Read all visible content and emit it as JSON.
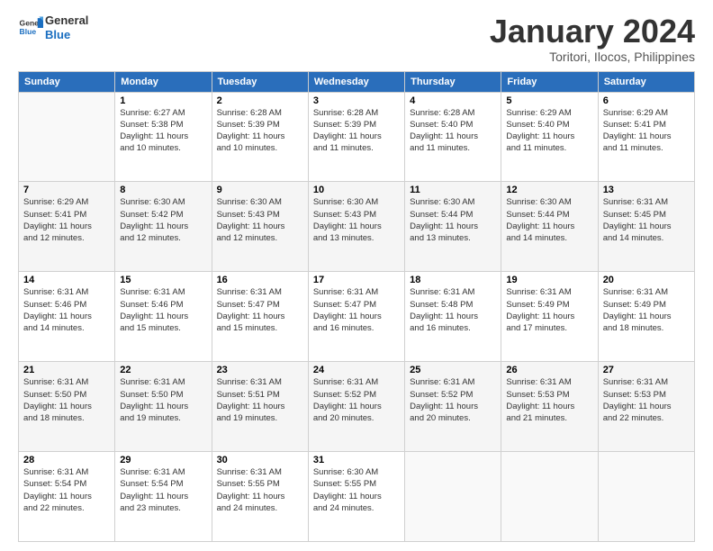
{
  "logo": {
    "line1": "General",
    "line2": "Blue"
  },
  "title": "January 2024",
  "subtitle": "Toritori, Ilocos, Philippines",
  "days_header": [
    "Sunday",
    "Monday",
    "Tuesday",
    "Wednesday",
    "Thursday",
    "Friday",
    "Saturday"
  ],
  "weeks": [
    [
      {
        "num": "",
        "info": ""
      },
      {
        "num": "1",
        "info": "Sunrise: 6:27 AM\nSunset: 5:38 PM\nDaylight: 11 hours\nand 10 minutes."
      },
      {
        "num": "2",
        "info": "Sunrise: 6:28 AM\nSunset: 5:39 PM\nDaylight: 11 hours\nand 10 minutes."
      },
      {
        "num": "3",
        "info": "Sunrise: 6:28 AM\nSunset: 5:39 PM\nDaylight: 11 hours\nand 11 minutes."
      },
      {
        "num": "4",
        "info": "Sunrise: 6:28 AM\nSunset: 5:40 PM\nDaylight: 11 hours\nand 11 minutes."
      },
      {
        "num": "5",
        "info": "Sunrise: 6:29 AM\nSunset: 5:40 PM\nDaylight: 11 hours\nand 11 minutes."
      },
      {
        "num": "6",
        "info": "Sunrise: 6:29 AM\nSunset: 5:41 PM\nDaylight: 11 hours\nand 11 minutes."
      }
    ],
    [
      {
        "num": "7",
        "info": "Sunrise: 6:29 AM\nSunset: 5:41 PM\nDaylight: 11 hours\nand 12 minutes."
      },
      {
        "num": "8",
        "info": "Sunrise: 6:30 AM\nSunset: 5:42 PM\nDaylight: 11 hours\nand 12 minutes."
      },
      {
        "num": "9",
        "info": "Sunrise: 6:30 AM\nSunset: 5:43 PM\nDaylight: 11 hours\nand 12 minutes."
      },
      {
        "num": "10",
        "info": "Sunrise: 6:30 AM\nSunset: 5:43 PM\nDaylight: 11 hours\nand 13 minutes."
      },
      {
        "num": "11",
        "info": "Sunrise: 6:30 AM\nSunset: 5:44 PM\nDaylight: 11 hours\nand 13 minutes."
      },
      {
        "num": "12",
        "info": "Sunrise: 6:30 AM\nSunset: 5:44 PM\nDaylight: 11 hours\nand 14 minutes."
      },
      {
        "num": "13",
        "info": "Sunrise: 6:31 AM\nSunset: 5:45 PM\nDaylight: 11 hours\nand 14 minutes."
      }
    ],
    [
      {
        "num": "14",
        "info": "Sunrise: 6:31 AM\nSunset: 5:46 PM\nDaylight: 11 hours\nand 14 minutes."
      },
      {
        "num": "15",
        "info": "Sunrise: 6:31 AM\nSunset: 5:46 PM\nDaylight: 11 hours\nand 15 minutes."
      },
      {
        "num": "16",
        "info": "Sunrise: 6:31 AM\nSunset: 5:47 PM\nDaylight: 11 hours\nand 15 minutes."
      },
      {
        "num": "17",
        "info": "Sunrise: 6:31 AM\nSunset: 5:47 PM\nDaylight: 11 hours\nand 16 minutes."
      },
      {
        "num": "18",
        "info": "Sunrise: 6:31 AM\nSunset: 5:48 PM\nDaylight: 11 hours\nand 16 minutes."
      },
      {
        "num": "19",
        "info": "Sunrise: 6:31 AM\nSunset: 5:49 PM\nDaylight: 11 hours\nand 17 minutes."
      },
      {
        "num": "20",
        "info": "Sunrise: 6:31 AM\nSunset: 5:49 PM\nDaylight: 11 hours\nand 18 minutes."
      }
    ],
    [
      {
        "num": "21",
        "info": "Sunrise: 6:31 AM\nSunset: 5:50 PM\nDaylight: 11 hours\nand 18 minutes."
      },
      {
        "num": "22",
        "info": "Sunrise: 6:31 AM\nSunset: 5:50 PM\nDaylight: 11 hours\nand 19 minutes."
      },
      {
        "num": "23",
        "info": "Sunrise: 6:31 AM\nSunset: 5:51 PM\nDaylight: 11 hours\nand 19 minutes."
      },
      {
        "num": "24",
        "info": "Sunrise: 6:31 AM\nSunset: 5:52 PM\nDaylight: 11 hours\nand 20 minutes."
      },
      {
        "num": "25",
        "info": "Sunrise: 6:31 AM\nSunset: 5:52 PM\nDaylight: 11 hours\nand 20 minutes."
      },
      {
        "num": "26",
        "info": "Sunrise: 6:31 AM\nSunset: 5:53 PM\nDaylight: 11 hours\nand 21 minutes."
      },
      {
        "num": "27",
        "info": "Sunrise: 6:31 AM\nSunset: 5:53 PM\nDaylight: 11 hours\nand 22 minutes."
      }
    ],
    [
      {
        "num": "28",
        "info": "Sunrise: 6:31 AM\nSunset: 5:54 PM\nDaylight: 11 hours\nand 22 minutes."
      },
      {
        "num": "29",
        "info": "Sunrise: 6:31 AM\nSunset: 5:54 PM\nDaylight: 11 hours\nand 23 minutes."
      },
      {
        "num": "30",
        "info": "Sunrise: 6:31 AM\nSunset: 5:55 PM\nDaylight: 11 hours\nand 24 minutes."
      },
      {
        "num": "31",
        "info": "Sunrise: 6:30 AM\nSunset: 5:55 PM\nDaylight: 11 hours\nand 24 minutes."
      },
      {
        "num": "",
        "info": ""
      },
      {
        "num": "",
        "info": ""
      },
      {
        "num": "",
        "info": ""
      }
    ]
  ]
}
